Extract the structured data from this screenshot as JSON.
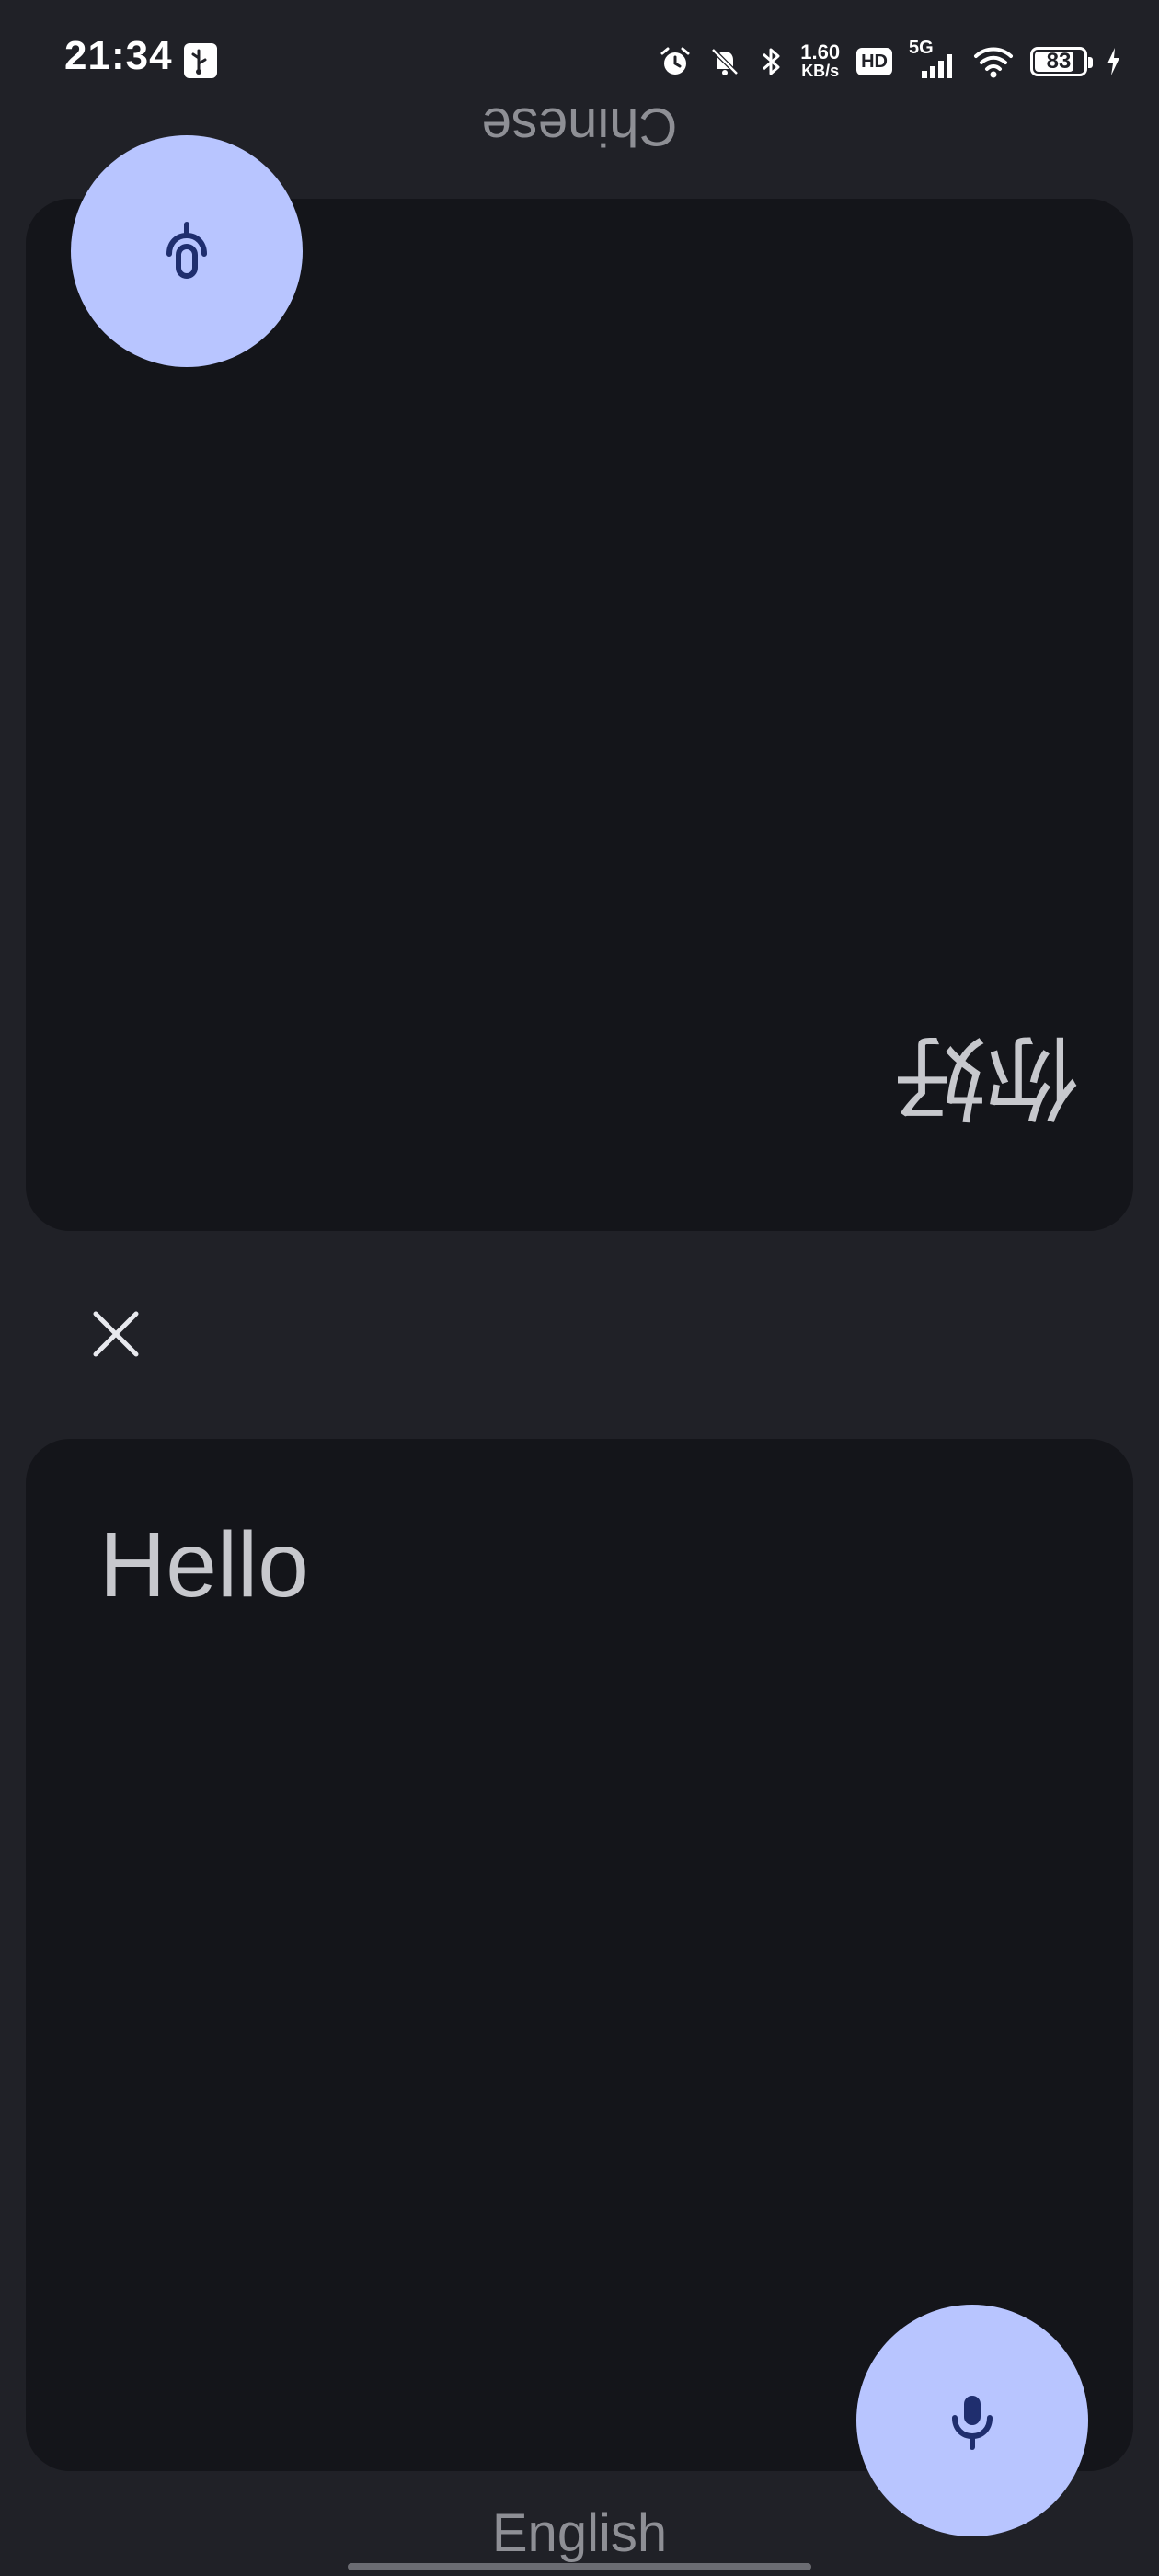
{
  "status_bar": {
    "time": "21:34",
    "net_speed_value": "1.60",
    "net_speed_unit": "KB/s",
    "hd_label": "HD",
    "network_label": "5G",
    "battery_level": "83",
    "icons": [
      "usb-debug-icon",
      "alarm-icon",
      "bell-muted-icon",
      "bluetooth-icon",
      "signal-icon",
      "wifi-icon",
      "battery-icon",
      "charging-icon"
    ]
  },
  "conversation": {
    "top": {
      "language": "Chinese",
      "text": "你好"
    },
    "bottom": {
      "language": "English",
      "text": "Hello"
    }
  },
  "controls": {
    "clear_icon": "close-icon",
    "mic_icon": "microphone-icon"
  },
  "colors": {
    "background": "#202127",
    "panel": "#14151a",
    "accent": "#b8c5ff",
    "accent_icon": "#1f2e6e",
    "text": "#c7c8cd",
    "label": "#8e8f95"
  }
}
